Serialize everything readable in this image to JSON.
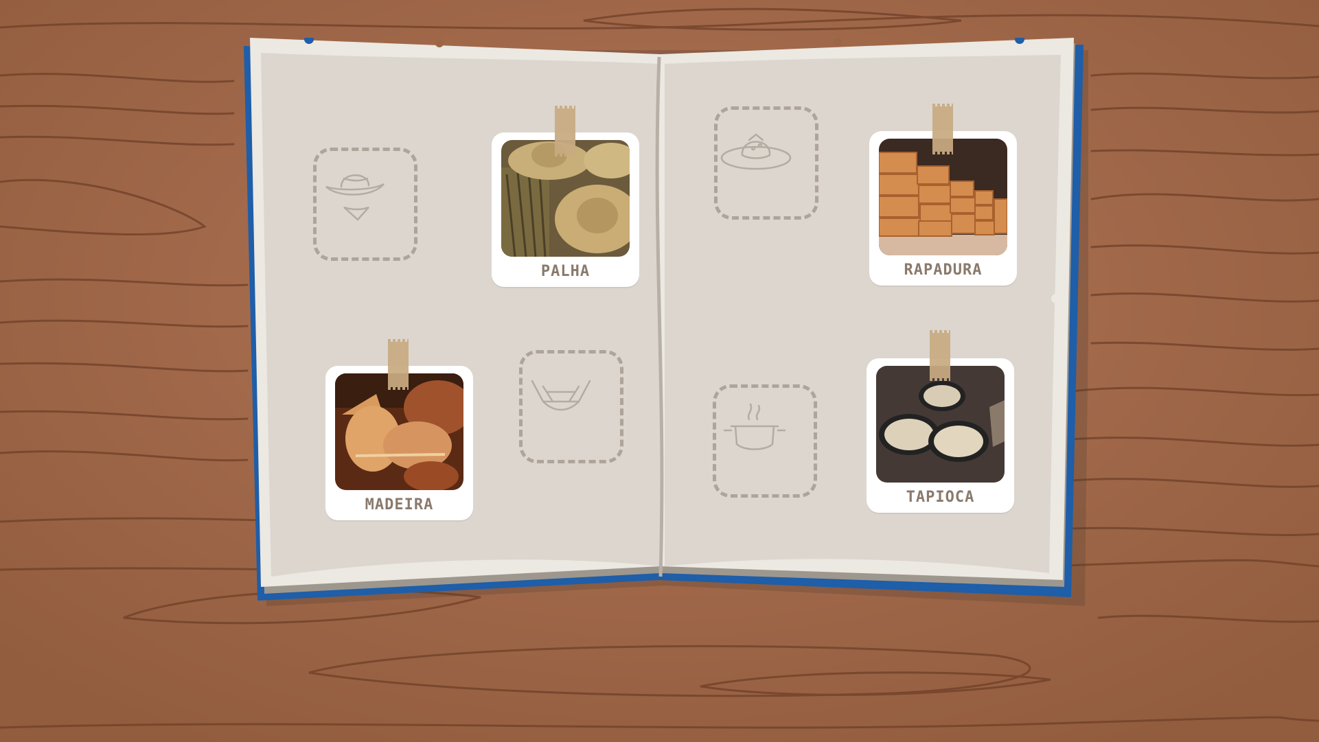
{
  "scene": {
    "colors": {
      "wood": "#9c6646",
      "wood_grain": "#6e3f28",
      "book_cover": "#1f5ea8",
      "page": "#dcd6cf",
      "page_edge": "#ece8e2",
      "slot_dash": "#aea49a",
      "label": "#8a7a6c",
      "tape": "#c8ab82"
    }
  },
  "cards": [
    {
      "label": "PALHA",
      "photo": "straw-hats-photo"
    },
    {
      "label": "RAPADURA",
      "photo": "rapadura-blocks-photo"
    },
    {
      "label": "MADEIRA",
      "photo": "wood-carving-photo"
    },
    {
      "label": "TAPIOCA",
      "photo": "tapioca-pans-photo"
    }
  ],
  "slots": [
    {
      "icon": "hat-and-scarf-icon"
    },
    {
      "icon": "hammock-icon"
    },
    {
      "icon": "cheese-on-plate-icon"
    },
    {
      "icon": "cooking-pot-icon"
    }
  ]
}
